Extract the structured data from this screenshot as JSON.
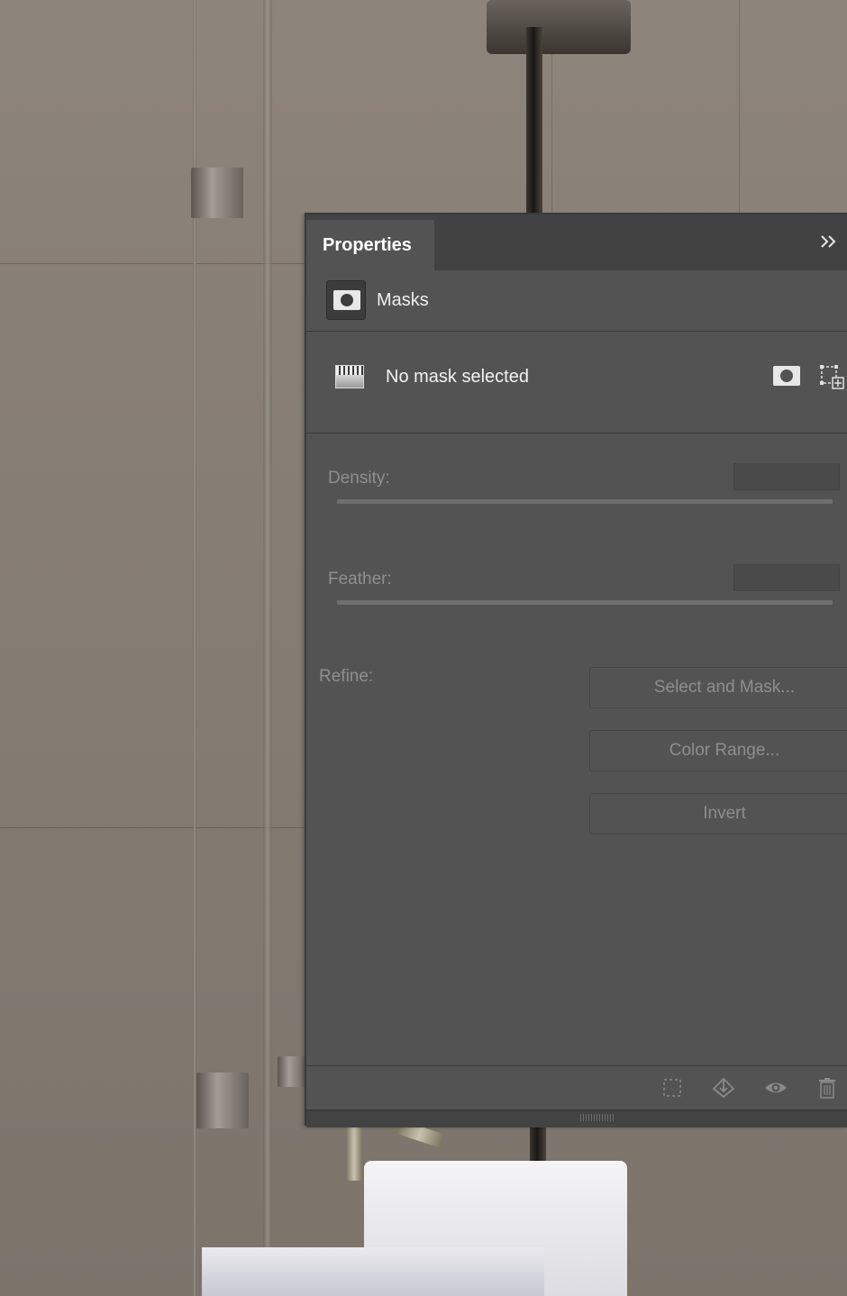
{
  "panel": {
    "tab_label": "Properties",
    "menu_glyph": "»",
    "section_label": "Masks",
    "mask_status": "No mask selected",
    "density_label": "Density:",
    "density_value": "",
    "feather_label": "Feather:",
    "feather_value": "",
    "refine_label": "Refine:",
    "buttons": {
      "select_and_mask": "Select and Mask...",
      "color_range": "Color Range...",
      "invert": "Invert"
    },
    "icons": {
      "section": "mask-icon",
      "gradient": "gradient-thumbnail-icon",
      "add_pixel_mask": "pixel-mask-icon",
      "add_vector_mask": "vector-mask-icon",
      "load_selection": "selection-from-mask-icon",
      "apply_mask": "apply-mask-icon",
      "toggle_visibility": "eye-icon",
      "delete_mask": "trash-icon"
    },
    "colors": {
      "panel_bg": "#535353",
      "tab_bar_bg": "#424242",
      "text_active": "#f2f2f2",
      "text_disabled": "#8f8f8f"
    }
  }
}
